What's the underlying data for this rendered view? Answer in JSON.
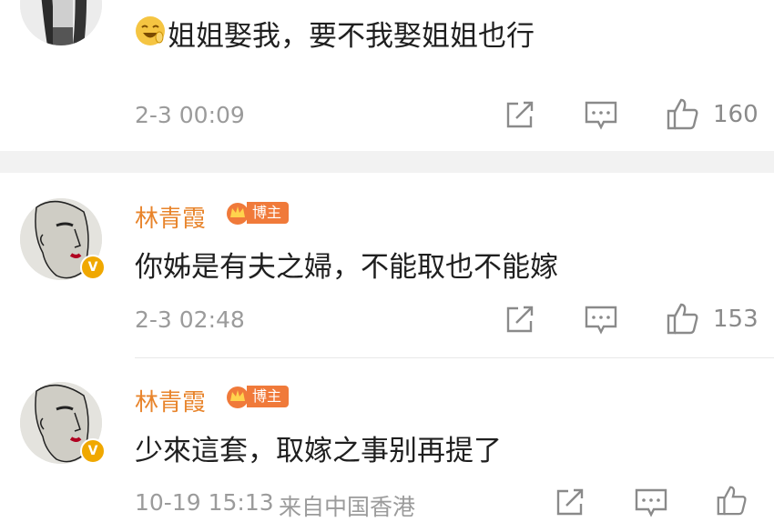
{
  "comments": [
    {
      "text": "姐姐娶我，要不我娶姐姐也行",
      "time": "2-3 00:09",
      "likes": "160"
    },
    {
      "username": "林青霞",
      "host_tag": "博主",
      "text": "你姊是有夫之婦，不能取也不能嫁",
      "time": "2-3 02:48",
      "likes": "153"
    },
    {
      "username": "林青霞",
      "host_tag": "博主",
      "text": "少來這套，取嫁之事别再提了",
      "time": "10-19 15:13",
      "location": "来自中国香港"
    }
  ],
  "colors": {
    "username": "#e8842b",
    "host_tag_bg": "#f07a3a",
    "verified_badge": "#f0a800",
    "meta_text": "#9b9b9b",
    "emoji": "#f5c542"
  },
  "icons": [
    "share-icon",
    "comment-icon",
    "like-icon",
    "laughing-emoji-icon",
    "crown-icon",
    "verified-icon"
  ]
}
